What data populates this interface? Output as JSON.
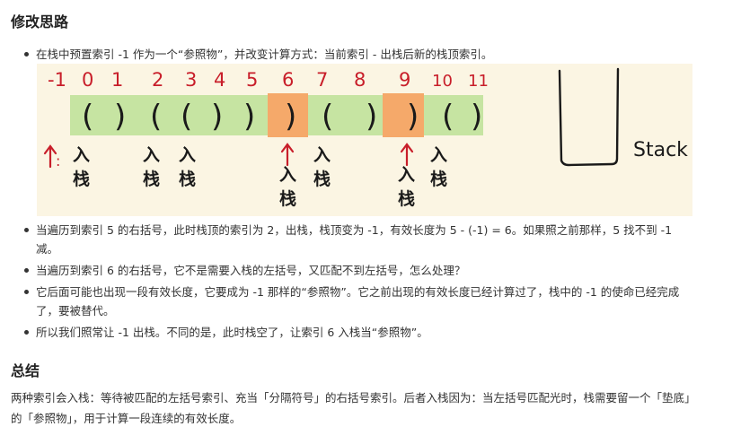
{
  "section1": {
    "title": "修改思路",
    "bullet_intro": "在栈中预置索引 -1 作为一个“参照物”，并改变计算方式：当前索引 - 出栈后新的栈顶索引。",
    "bullets": [
      "当遍历到索引 5 的右括号，此时栈顶的索引为 2，出栈，栈顶变为 -1，有效长度为 5 - (-1) = 6。如果照之前那样，5 找不到 -1 减。",
      "当遍历到索引 6 的右括号，它不是需要入栈的左括号，又匹配不到左括号，怎么处理？",
      "它后面可能也出现一段有效长度，它要成为 -1 那样的“参照物”。它之前出现的有效长度已经计算过了，栈中的 -1 的使命已经完成了，要被替代。",
      "所以我们照常让 -1 出栈。不同的是，此时栈空了，让索引 6 入栈当“参照物”。"
    ]
  },
  "section2": {
    "title": "总结",
    "paragraph": "两种索引会入栈：等待被匹配的左括号索引、充当「分隔符号」的右括号索引。后者入栈因为：当左括号匹配光时，栈需要留一个「垫底」的「参照物」，用于计算一段连续的有效长度。"
  },
  "diagram": {
    "indices": [
      "-1",
      "0",
      "1",
      "2",
      "3",
      "4",
      "5",
      "6",
      "7",
      "8",
      "9",
      "10",
      "11"
    ],
    "chars": [
      "(",
      ")",
      "(",
      "(",
      ")",
      ")",
      ")",
      "(",
      ")",
      ")",
      "(",
      ")"
    ],
    "push_label_a": "入",
    "push_label_b": "栈",
    "stack_label": "Stack",
    "colors": {
      "index_red": "#c81e2a",
      "cell_green": "#c6e4a2",
      "cell_orange": "#f5a96a",
      "ink": "#1a1a1a",
      "background": "#fbf5e3"
    }
  }
}
